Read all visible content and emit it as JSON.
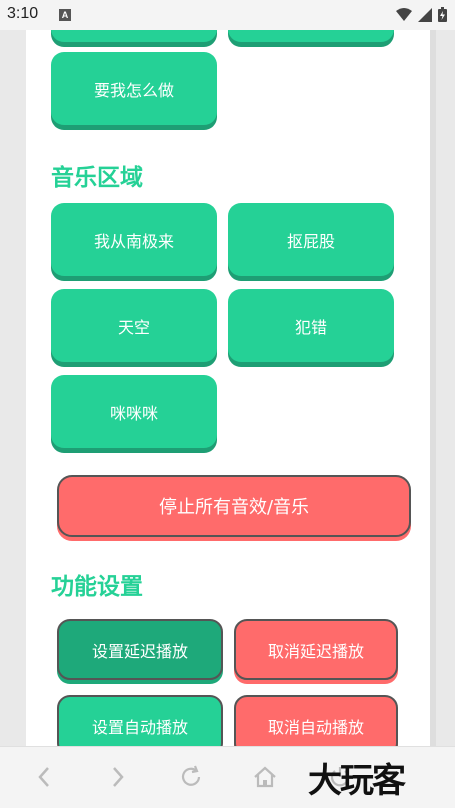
{
  "status_bar": {
    "time": "3:10",
    "notif_letter": "A"
  },
  "sound_section": {
    "last_button": "要我怎么做"
  },
  "music_section": {
    "title": "音乐区域",
    "buttons": [
      "我从南极来",
      "抠屁股",
      "天空",
      "犯错",
      "咪咪咪"
    ]
  },
  "stop_button": "停止所有音效/音乐",
  "function_section": {
    "title": "功能设置",
    "set_delay": "设置延迟播放",
    "cancel_delay": "取消延迟播放",
    "set_auto": "设置自动播放",
    "cancel_auto": "取消自动播放"
  },
  "watermark": "大玩客",
  "colors": {
    "primary": "#25d196",
    "primary_dark": "#1ea97a",
    "danger": "#ff6b6b"
  }
}
